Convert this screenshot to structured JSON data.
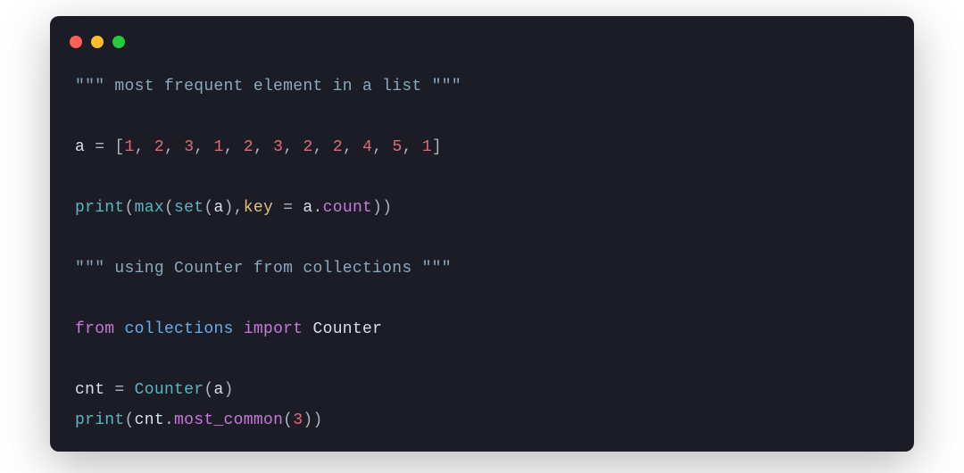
{
  "window": {
    "dots": {
      "close": "#ff5f56",
      "min": "#ffbd2e",
      "max": "#27c93f"
    }
  },
  "palette": {
    "bg": "#1b1c25",
    "string": "#8aa9c1",
    "default": "#d6e1ec",
    "punct": "#a9b4c0",
    "num": "#e06c75",
    "func": "#56b6c2",
    "kwarg": "#e5c07b",
    "attr": "#c678dd",
    "keyword": "#c678dd",
    "module": "#61afef"
  },
  "code": {
    "lines": [
      [
        {
          "t": "\"\"\"",
          "c": "string"
        },
        {
          "t": " most frequent element in a list ",
          "c": "string"
        },
        {
          "t": "\"\"\"",
          "c": "string"
        }
      ],
      [],
      [
        {
          "t": "a ",
          "c": "default"
        },
        {
          "t": "= [",
          "c": "punct"
        },
        {
          "t": "1",
          "c": "num"
        },
        {
          "t": ", ",
          "c": "punct"
        },
        {
          "t": "2",
          "c": "num"
        },
        {
          "t": ", ",
          "c": "punct"
        },
        {
          "t": "3",
          "c": "num"
        },
        {
          "t": ", ",
          "c": "punct"
        },
        {
          "t": "1",
          "c": "num"
        },
        {
          "t": ", ",
          "c": "punct"
        },
        {
          "t": "2",
          "c": "num"
        },
        {
          "t": ", ",
          "c": "punct"
        },
        {
          "t": "3",
          "c": "num"
        },
        {
          "t": ", ",
          "c": "punct"
        },
        {
          "t": "2",
          "c": "num"
        },
        {
          "t": ", ",
          "c": "punct"
        },
        {
          "t": "2",
          "c": "num"
        },
        {
          "t": ", ",
          "c": "punct"
        },
        {
          "t": "4",
          "c": "num"
        },
        {
          "t": ", ",
          "c": "punct"
        },
        {
          "t": "5",
          "c": "num"
        },
        {
          "t": ", ",
          "c": "punct"
        },
        {
          "t": "1",
          "c": "num"
        },
        {
          "t": "]",
          "c": "punct"
        }
      ],
      [],
      [
        {
          "t": "print",
          "c": "func"
        },
        {
          "t": "(",
          "c": "punct"
        },
        {
          "t": "max",
          "c": "func"
        },
        {
          "t": "(",
          "c": "punct"
        },
        {
          "t": "set",
          "c": "func"
        },
        {
          "t": "(",
          "c": "punct"
        },
        {
          "t": "a",
          "c": "default"
        },
        {
          "t": "),",
          "c": "punct"
        },
        {
          "t": "key",
          "c": "kwarg"
        },
        {
          "t": " = ",
          "c": "punct"
        },
        {
          "t": "a",
          "c": "default"
        },
        {
          "t": ".",
          "c": "punct"
        },
        {
          "t": "count",
          "c": "attr"
        },
        {
          "t": "))",
          "c": "punct"
        }
      ],
      [],
      [
        {
          "t": "\"\"\"",
          "c": "string"
        },
        {
          "t": " using Counter from collections ",
          "c": "string"
        },
        {
          "t": "\"\"\"",
          "c": "string"
        }
      ],
      [],
      [
        {
          "t": "from",
          "c": "keyword"
        },
        {
          "t": " ",
          "c": "default"
        },
        {
          "t": "collections",
          "c": "module"
        },
        {
          "t": " ",
          "c": "default"
        },
        {
          "t": "import",
          "c": "keyword"
        },
        {
          "t": " ",
          "c": "default"
        },
        {
          "t": "Counter",
          "c": "default"
        }
      ],
      [],
      [
        {
          "t": "cnt ",
          "c": "default"
        },
        {
          "t": "= ",
          "c": "punct"
        },
        {
          "t": "Counter",
          "c": "func"
        },
        {
          "t": "(",
          "c": "punct"
        },
        {
          "t": "a",
          "c": "default"
        },
        {
          "t": ")",
          "c": "punct"
        }
      ],
      [
        {
          "t": "print",
          "c": "func"
        },
        {
          "t": "(",
          "c": "punct"
        },
        {
          "t": "cnt",
          "c": "default"
        },
        {
          "t": ".",
          "c": "punct"
        },
        {
          "t": "most_common",
          "c": "attr"
        },
        {
          "t": "(",
          "c": "punct"
        },
        {
          "t": "3",
          "c": "num"
        },
        {
          "t": "))",
          "c": "punct"
        }
      ]
    ]
  }
}
